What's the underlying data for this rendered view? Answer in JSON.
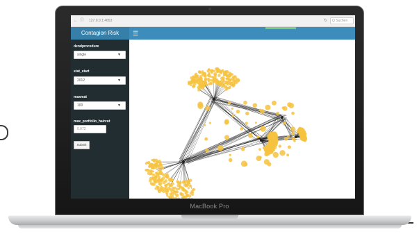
{
  "browser": {
    "url": "127.0.0.1:4653",
    "search_placeholder": "Q Suchen"
  },
  "app": {
    "title": "Contagion Risk",
    "menu_icon": "hamburger-icon"
  },
  "sidebar": {
    "fields": [
      {
        "label": "dendprocedure",
        "type": "select",
        "value": "single"
      },
      {
        "label": "stat_start",
        "type": "select",
        "value": "2012"
      },
      {
        "label": "maxmat",
        "type": "select",
        "value": "100"
      },
      {
        "label": "max_portfolio_haircut",
        "type": "text",
        "value": "0.072"
      }
    ],
    "submit_label": "Submit"
  },
  "device": {
    "brand": "MacBook Pro"
  },
  "colors": {
    "header": "#3c8dbc",
    "logo": "#367fa9",
    "sidebar": "#222d32",
    "node": "#f6c340",
    "edge": "#1a1a1a"
  }
}
